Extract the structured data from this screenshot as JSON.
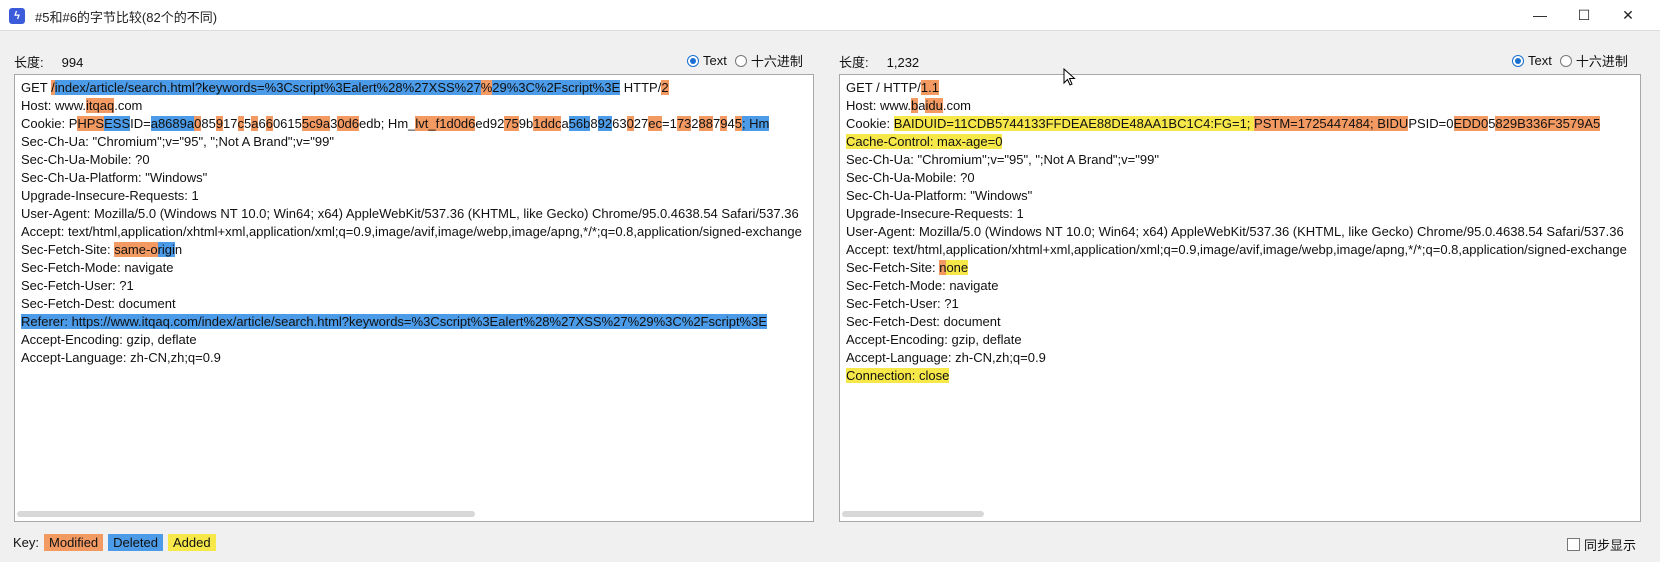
{
  "window": {
    "title": "#5和#6的字节比较(82个的不同)",
    "app_icon": "lightning-icon",
    "minimize_glyph": "—",
    "maximize_glyph": "☐",
    "close_glyph": "✕"
  },
  "left": {
    "length_label": "长度:",
    "length_value": "994",
    "mode_text": "Text",
    "mode_hex": "十六进制"
  },
  "right": {
    "length_label": "长度:",
    "length_value": "1,232",
    "mode_text": "Text",
    "mode_hex": "十六进制"
  },
  "left_lines": [
    [
      [
        "",
        "GET "
      ],
      [
        "m",
        "/"
      ],
      [
        "d",
        "index/article/search.html?keywords=%3Cscript%3Ealert%28%27XSS%27"
      ],
      [
        "m",
        "%"
      ],
      [
        "d",
        "29%3C%2Fscript%3E"
      ],
      [
        "",
        " HTTP/"
      ],
      [
        "m",
        "2"
      ]
    ],
    [
      [
        "",
        "Host: www."
      ],
      [
        "m",
        "itqaq"
      ],
      [
        "",
        ".com"
      ]
    ],
    [
      [
        "",
        "Cookie: P"
      ],
      [
        "m",
        "HPS"
      ],
      [
        "d",
        "ESS"
      ],
      [
        "",
        "ID="
      ],
      [
        "d",
        "a8689a"
      ],
      [
        "m",
        "0"
      ],
      [
        "",
        "85"
      ],
      [
        "m",
        "9"
      ],
      [
        "",
        "17"
      ],
      [
        "m",
        "c"
      ],
      [
        "",
        "5"
      ],
      [
        "m",
        "a"
      ],
      [
        "",
        "6"
      ],
      [
        "m",
        "6"
      ],
      [
        "",
        "0615"
      ],
      [
        "m",
        "5c9a"
      ],
      [
        "",
        "3"
      ],
      [
        "m",
        "0d6"
      ],
      [
        "",
        "edb; Hm_"
      ],
      [
        "m",
        "lvt_f1d0d6"
      ],
      [
        "",
        "ed92"
      ],
      [
        "m",
        "75"
      ],
      [
        "",
        "9b"
      ],
      [
        "m",
        "1ddc"
      ],
      [
        "",
        "a"
      ],
      [
        "d",
        "56b"
      ],
      [
        "",
        "8"
      ],
      [
        "d",
        "92"
      ],
      [
        "",
        "63"
      ],
      [
        "m",
        "0"
      ],
      [
        "",
        "27"
      ],
      [
        "m",
        "ec"
      ],
      [
        "",
        "=1"
      ],
      [
        "m",
        "73"
      ],
      [
        "",
        "2"
      ],
      [
        "m",
        "88"
      ],
      [
        "",
        "7"
      ],
      [
        "m",
        "9"
      ],
      [
        "",
        "4"
      ],
      [
        "m",
        "5"
      ],
      [
        "d",
        "; Hm"
      ]
    ],
    [
      [
        "",
        "Sec-Ch-Ua: \"Chromium\";v=\"95\", \";Not A Brand\";v=\"99\""
      ]
    ],
    [
      [
        "",
        "Sec-Ch-Ua-Mobile: ?0"
      ]
    ],
    [
      [
        "",
        "Sec-Ch-Ua-Platform: \"Windows\""
      ]
    ],
    [
      [
        "",
        "Upgrade-Insecure-Requests: 1"
      ]
    ],
    [
      [
        "",
        "User-Agent: Mozilla/5.0 (Windows NT 10.0; Win64; x64) AppleWebKit/537.36 (KHTML, like Gecko) Chrome/95.0.4638.54 Safari/537.36"
      ]
    ],
    [
      [
        "",
        "Accept: text/html,application/xhtml+xml,application/xml;q=0.9,image/avif,image/webp,image/apng,*/*;q=0.8,application/signed-exchange"
      ]
    ],
    [
      [
        "",
        "Sec-Fetch-Site: "
      ],
      [
        "m",
        "same-o"
      ],
      [
        "d",
        "rigi"
      ],
      [
        "",
        "n"
      ]
    ],
    [
      [
        "",
        "Sec-Fetch-Mode: navigate"
      ]
    ],
    [
      [
        "",
        "Sec-Fetch-User: ?1"
      ]
    ],
    [
      [
        "",
        "Sec-Fetch-Dest: document"
      ]
    ],
    [
      [
        "d",
        "Referer: https://www.itqaq.com/index/article/search.html?keywords=%3Cscript%3Ealert%28%27XSS%27%29%3C%2Fscript%3E"
      ]
    ],
    [
      [
        "",
        "Accept-Encoding: gzip, deflate"
      ]
    ],
    [
      [
        "",
        "Accept-Language: zh-CN,zh;q=0.9"
      ]
    ]
  ],
  "right_lines": [
    [
      [
        "",
        "GET / HTTP/"
      ],
      [
        "m",
        "1.1"
      ]
    ],
    [
      [
        "",
        "Host: www."
      ],
      [
        "m",
        "b"
      ],
      [
        "",
        "a"
      ],
      [
        "m",
        "idu"
      ],
      [
        "",
        ".com"
      ]
    ],
    [
      [
        "",
        "Cookie: "
      ],
      [
        "a",
        "BAIDUID=11CDB5744133FFDEAE88DE48AA1BC1C4:FG=1; "
      ],
      [
        "m",
        "P"
      ],
      [
        "m",
        "STM=1725447484; BIDU"
      ],
      [
        "",
        "PSID=0"
      ],
      [
        "m",
        "EDD0"
      ],
      [
        "",
        "5"
      ],
      [
        "m",
        "829B336F3579A5"
      ]
    ],
    [
      [
        "a",
        "Cache-Control: max-age=0"
      ]
    ],
    [
      [
        "",
        "Sec-Ch-Ua: \"Chromium\";v=\"95\", \";Not A Brand\";v=\"99\""
      ]
    ],
    [
      [
        "",
        "Sec-Ch-Ua-Mobile: ?0"
      ]
    ],
    [
      [
        "",
        "Sec-Ch-Ua-Platform: \"Windows\""
      ]
    ],
    [
      [
        "",
        "Upgrade-Insecure-Requests: 1"
      ]
    ],
    [
      [
        "",
        "User-Agent: Mozilla/5.0 (Windows NT 10.0; Win64; x64) AppleWebKit/537.36 (KHTML, like Gecko) Chrome/95.0.4638.54 Safari/537.36"
      ]
    ],
    [
      [
        "",
        "Accept: text/html,application/xhtml+xml,application/xml;q=0.9,image/avif,image/webp,image/apng,*/*;q=0.8,application/signed-exchange"
      ]
    ],
    [
      [
        "",
        "Sec-Fetch-Site: "
      ],
      [
        "m",
        "n"
      ],
      [
        "a",
        "one"
      ]
    ],
    [
      [
        "",
        "Sec-Fetch-Mode: navigate"
      ]
    ],
    [
      [
        "",
        "Sec-Fetch-User: ?1"
      ]
    ],
    [
      [
        "",
        "Sec-Fetch-Dest: document"
      ]
    ],
    [
      [
        "",
        "Accept-Encoding: gzip, deflate"
      ]
    ],
    [
      [
        "",
        "Accept-Language: zh-CN,zh;q=0.9"
      ]
    ],
    [
      [
        "a",
        "Connection: close"
      ]
    ]
  ],
  "key": {
    "label": "Key:",
    "modified": "Modified",
    "deleted": "Deleted",
    "added": "Added"
  },
  "sync_label": "同步显示",
  "colors": {
    "modified": "#f39a62",
    "deleted": "#4b9be8",
    "added": "#f7e84a",
    "accent": "#1a6fd1"
  }
}
